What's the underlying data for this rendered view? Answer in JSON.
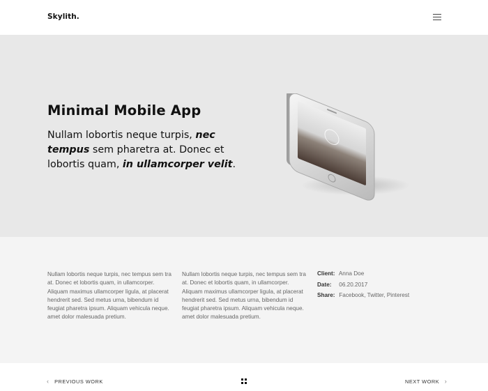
{
  "header": {
    "logo": "Skylith.",
    "menu_icon": "hamburger-menu-icon"
  },
  "hero": {
    "title": "Minimal Mobile App",
    "lead_part1": "Nullam lobortis neque turpis, ",
    "lead_em1": "nec tempus",
    "lead_part2": " sem pharetra at. Donec et lobortis quam, ",
    "lead_em2": "in ullamcorper velit",
    "lead_part3": ".",
    "image": "smartphone-mockup-image",
    "background_color": "#e8e8e8"
  },
  "details": {
    "column1": "Nullam lobortis neque turpis, nec tempus sem tra at. Donec et lobortis quam, in ullamcorper. Aliquam maximus ullamcorper ligula, at placerat hendrerit sed. Sed metus urna, bibendum id feugiat pharetra ipsum. Aliquam vehicula neque. amet dolor malesuada pretium.",
    "column2": "Nullam lobortis neque turpis, nec tempus sem tra at. Donec et lobortis quam, in ullamcorper. Aliquam maximus ullamcorper ligula, at placerat hendrerit sed. Sed metus urna, bibendum id feugiat pharetra ipsum. Aliquam vehicula neque. amet dolor malesuada pretium.",
    "meta": [
      {
        "label": "Client:",
        "value": "Anna Doe"
      },
      {
        "label": "Date:",
        "value": "06.20.2017"
      },
      {
        "label": "Share:",
        "value": "Facebook, Twitter, Pinterest"
      }
    ],
    "background_color": "#f4f4f4"
  },
  "footer": {
    "prev_label": "PREVIOUS WORK",
    "next_label": "NEXT WORK",
    "prev_icon": "chevron-left-icon",
    "next_icon": "chevron-right-icon",
    "grid_icon": "grid-icon"
  }
}
